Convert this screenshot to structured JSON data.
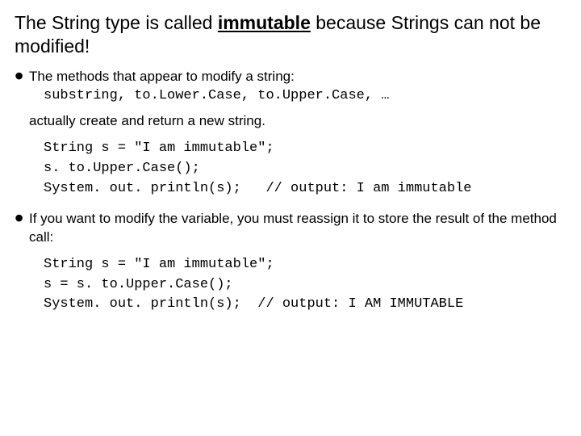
{
  "title": {
    "pre": "The String type is called ",
    "emph": "immutable",
    "post": " because Strings can not be modified!"
  },
  "bullet1": {
    "text": "The methods that appear to modify a string:",
    "methods": "substring, to.Lower.Case, to.Upper.Case, …"
  },
  "sentence": "actually create and return a new string.",
  "code1": "String s = \"I am immutable\";\ns. to.Upper.Case();\nSystem. out. println(s);   // output: I am immutable",
  "bullet2": "If you want to modify the variable, you must reassign it to store the result of the method call:",
  "code2": "String s = \"I am immutable\";\ns = s. to.Upper.Case();\nSystem. out. println(s);  // output: I AM IMMUTABLE"
}
